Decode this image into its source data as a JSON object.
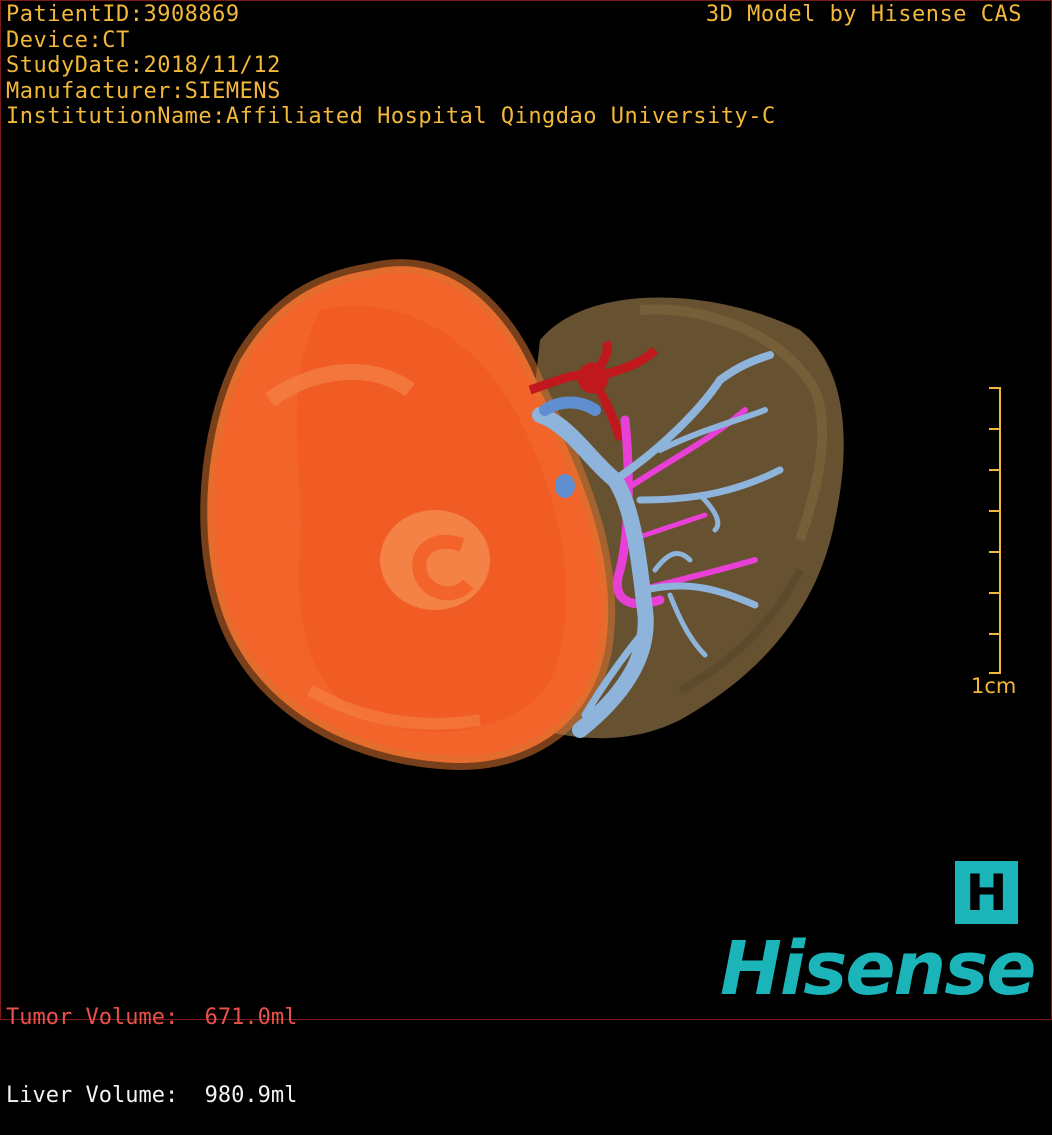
{
  "header": {
    "patient_id": "PatientID:3908869",
    "device": "Device:CT",
    "study_date": "StudyDate:2018/11/12",
    "manufacturer": "Manufacturer:SIEMENS",
    "institution": "InstitutionName:Affiliated Hospital Qingdao University-C",
    "credit": "3D Model by Hisense CAS"
  },
  "scale": {
    "label": "1cm"
  },
  "volumes": {
    "tumor": "Tumor Volume:  671.0ml",
    "liver": "Liver Volume:  980.9ml"
  },
  "logo": {
    "icon_letter": "H",
    "brand": "Hisense"
  },
  "colors": {
    "text_accent": "#f2b83a",
    "tumor": "#f2642a",
    "liver": "#6b5534",
    "portal_vein": "#8fb4dc",
    "hepatic_vein": "#e83fd6",
    "artery": "#c0181c",
    "brand": "#1bb5b9"
  }
}
